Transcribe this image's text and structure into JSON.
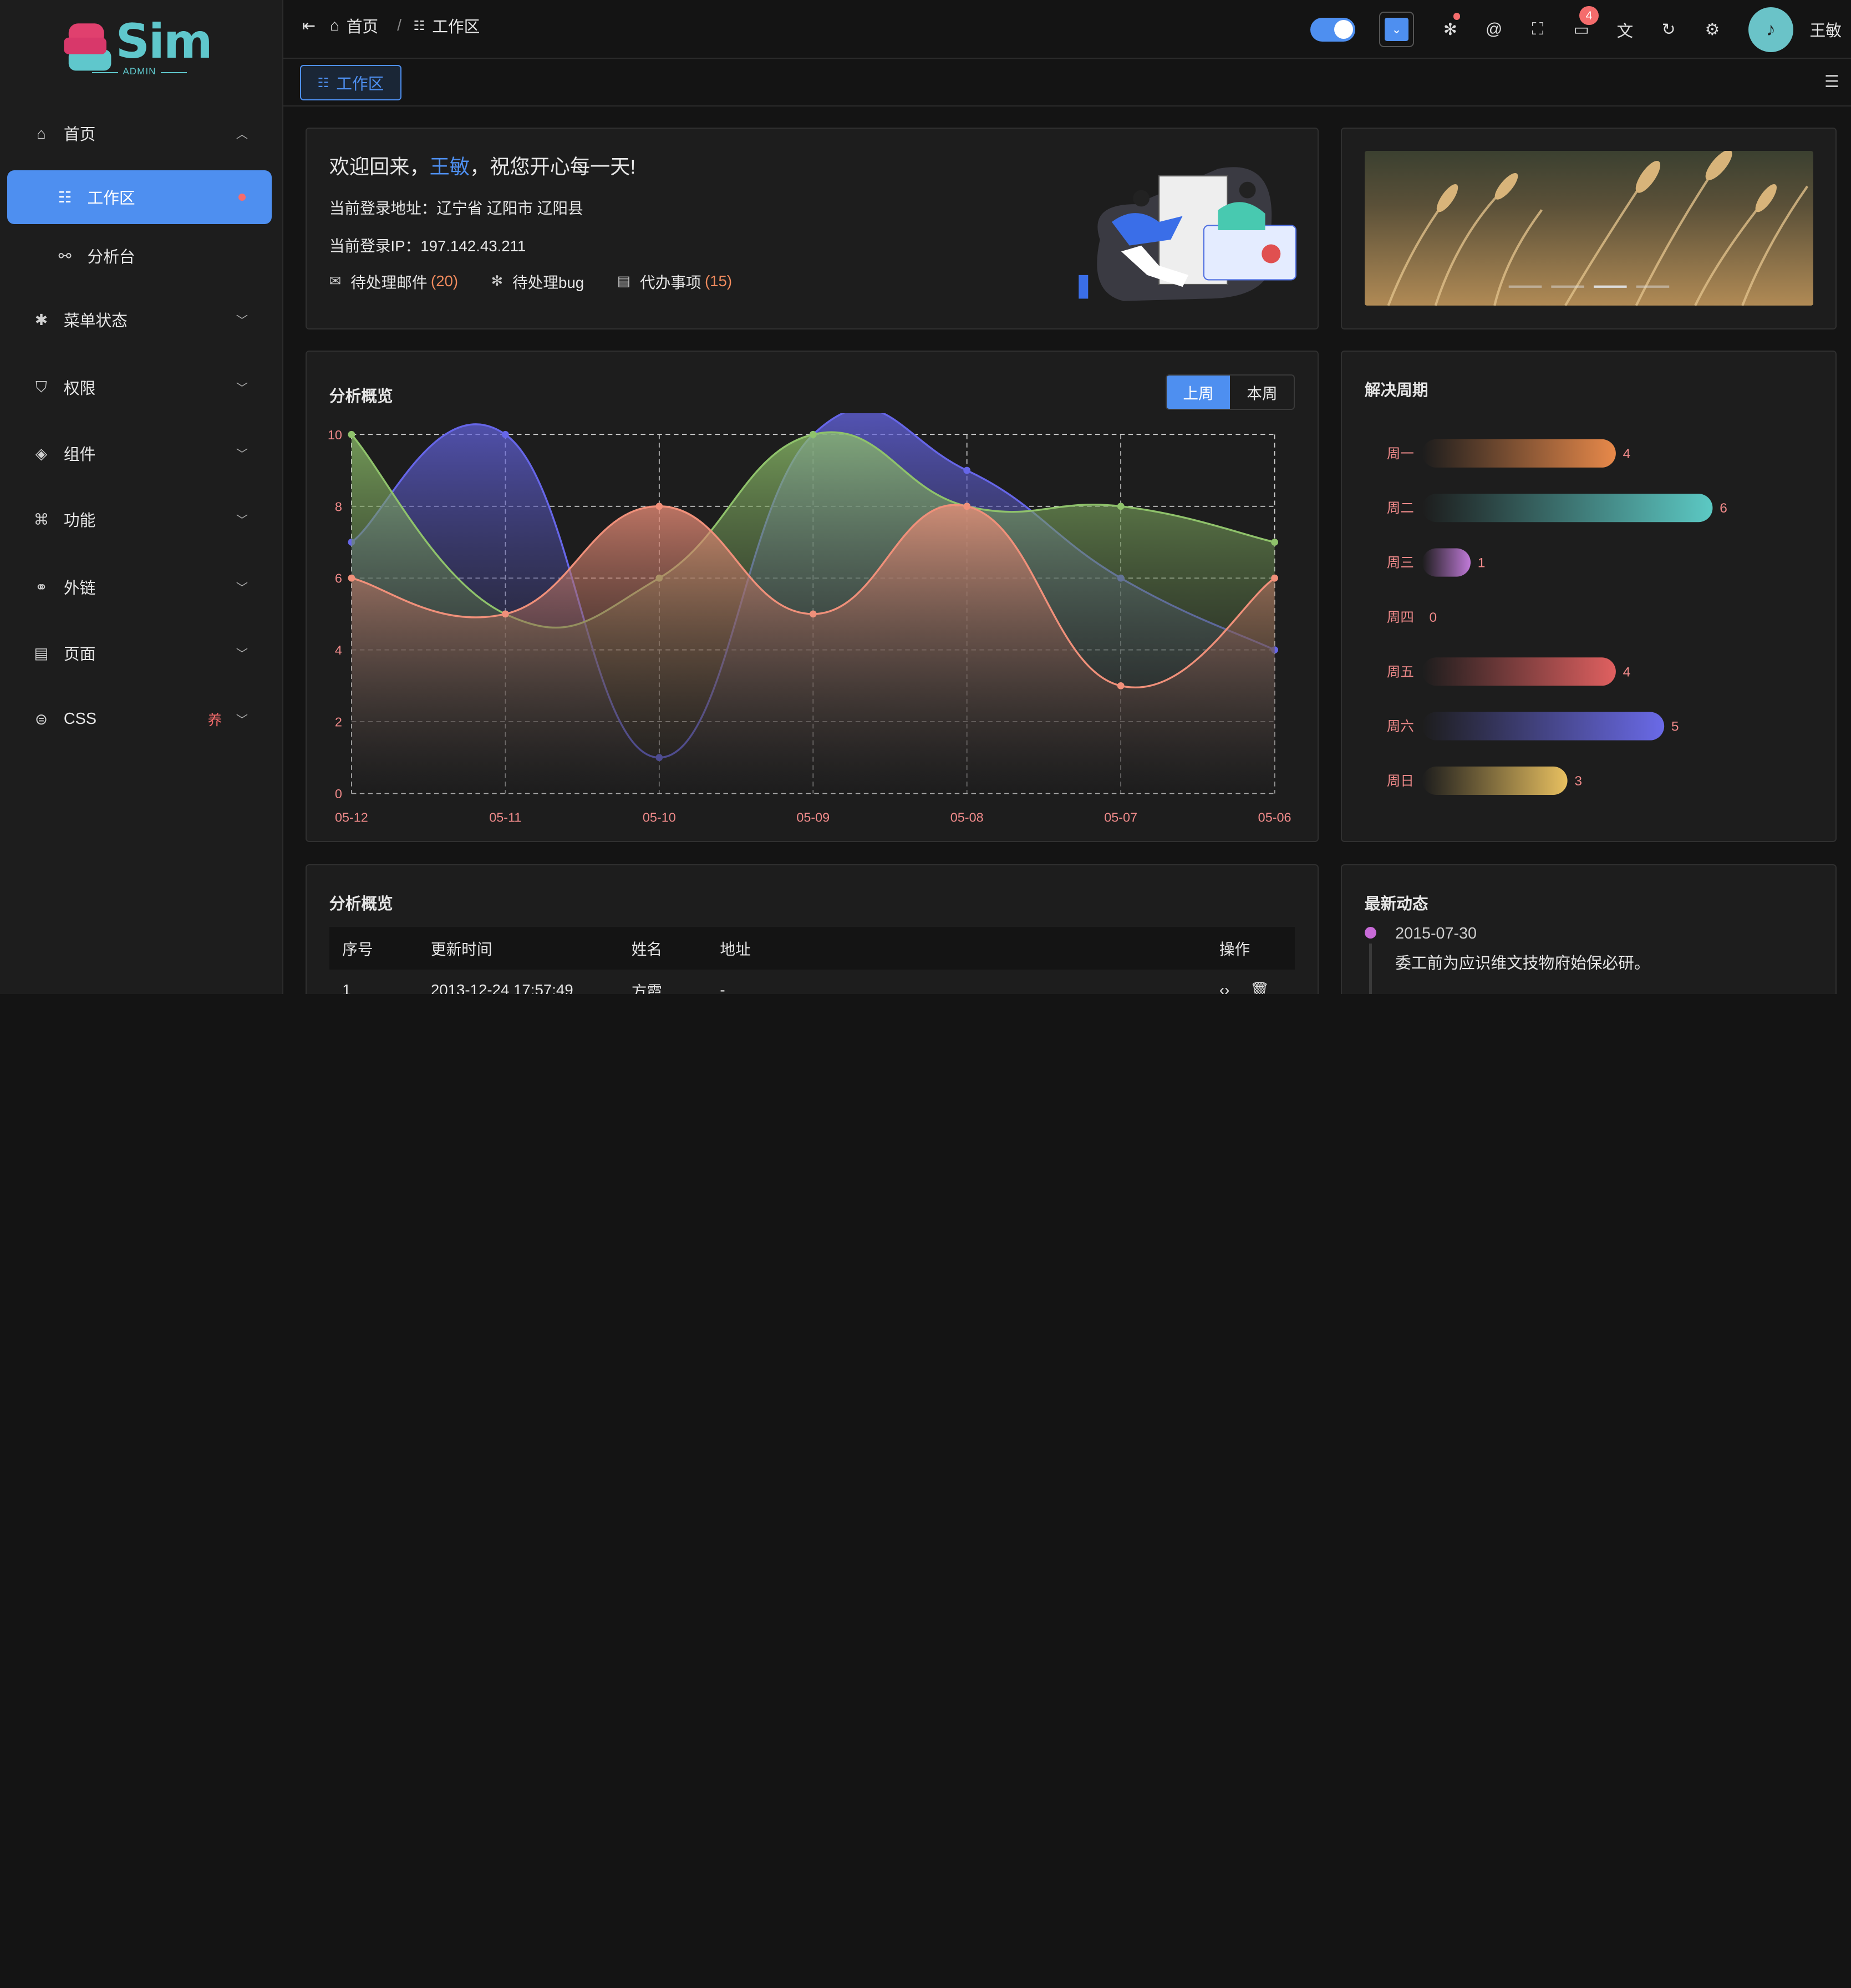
{
  "app": {
    "logo_text": "Sim",
    "logo_sub": "ADMIN"
  },
  "sidebar": {
    "items": [
      {
        "label": "首页",
        "icon": "home-icon",
        "expanded": true
      },
      {
        "label": "工作区",
        "icon": "list-icon",
        "active": true
      },
      {
        "label": "分析台",
        "icon": "analysis-icon"
      },
      {
        "label": "菜单状态",
        "icon": "asterisk-icon"
      },
      {
        "label": "权限",
        "icon": "shield-icon"
      },
      {
        "label": "组件",
        "icon": "layers-icon"
      },
      {
        "label": "功能",
        "icon": "grid-icon"
      },
      {
        "label": "外链",
        "icon": "link-icon"
      },
      {
        "label": "页面",
        "icon": "page-icon"
      },
      {
        "label": "CSS",
        "icon": "css-icon",
        "badge": "养"
      }
    ]
  },
  "header": {
    "breadcrumb": [
      "首页",
      "工作区"
    ],
    "notification_count": "4",
    "username": "王敏",
    "accent_color": "#4e8ff0"
  },
  "tabs": [
    {
      "label": "工作区"
    }
  ],
  "welcome": {
    "greeting_prefix": "欢迎回来，",
    "name": "王敏",
    "greeting_suffix": "，祝您开心每一天!",
    "address_line": "当前登录地址：辽宁省 辽阳市 辽阳县",
    "ip_line": "当前登录IP：197.142.43.211",
    "links": [
      {
        "label": "待处理邮件",
        "count": "(20)",
        "icon": "mail-icon"
      },
      {
        "label": "待处理bug",
        "count": "",
        "icon": "bug-icon"
      },
      {
        "label": "代办事项",
        "count": "(15)",
        "icon": "clipboard-icon"
      }
    ]
  },
  "analysis": {
    "title": "分析概览",
    "toggle": [
      "上周",
      "本周"
    ],
    "selected": "上周"
  },
  "chart_data": [
    {
      "type": "area",
      "title": "分析概览",
      "categories": [
        "05-12",
        "05-11",
        "05-10",
        "05-09",
        "05-08",
        "05-07",
        "05-06"
      ],
      "ylim": [
        0,
        10
      ],
      "yticks": [
        "0",
        "2",
        "4",
        "6",
        "8",
        "10"
      ],
      "grid": true,
      "series": [
        {
          "values": [
            7,
            10,
            1,
            10,
            9,
            6,
            4
          ],
          "color": "#6666e8"
        },
        {
          "values": [
            10,
            5,
            6,
            10,
            8,
            8,
            7
          ],
          "color": "#8fc26b"
        },
        {
          "values": [
            6,
            5,
            8,
            5,
            8,
            3,
            6
          ],
          "color": "#f0907a"
        }
      ]
    },
    {
      "type": "bar",
      "title": "解决周期",
      "categories": [
        "周一",
        "周二",
        "周三",
        "周四",
        "周五",
        "周六",
        "周日"
      ],
      "values": [
        4,
        6,
        1,
        0,
        4,
        5,
        3
      ],
      "colors": [
        "#e8894a",
        "#5cc9c4",
        "#c07ad8",
        "#888888",
        "#e06060",
        "#6a6ae8",
        "#e8c060"
      ],
      "max": 6
    }
  ],
  "cycle": {
    "title": "解决周期"
  },
  "table": {
    "title": "分析概览",
    "headers": [
      "序号",
      "更新时间",
      "姓名",
      "地址",
      "操作"
    ],
    "rows": [
      [
        "1",
        "2013-12-24 17:57:49",
        "方霞",
        "-"
      ]
    ]
  },
  "activity": {
    "title": "最新动态",
    "items": [
      {
        "date": "2015-07-30",
        "text": "委工前为应识维文技物府始保必研。"
      }
    ]
  }
}
